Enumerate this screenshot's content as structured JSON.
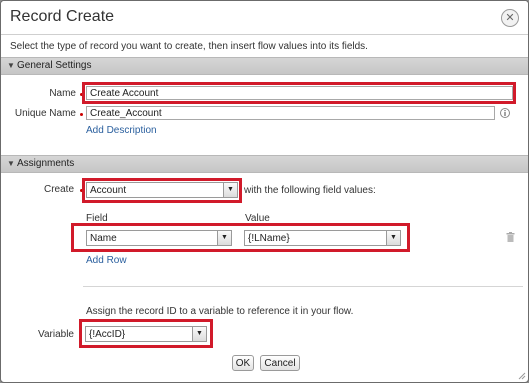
{
  "dialog": {
    "title": "Record Create",
    "intro": "Select the type of record you want to create, then insert flow values into its fields."
  },
  "general": {
    "header": "General Settings",
    "name_label": "Name",
    "name_value": "Create Account",
    "unique_label": "Unique Name",
    "unique_value": "Create_Account",
    "add_description": "Add Description"
  },
  "assignments": {
    "header": "Assignments",
    "create_label": "Create",
    "create_value": "Account",
    "with_text": "with the following field values:",
    "field_header": "Field",
    "value_header": "Value",
    "field_value": "Name",
    "value_value": "{!LName}",
    "add_row": "Add Row",
    "assign_note": "Assign the record ID to a variable to reference it in your flow.",
    "variable_label": "Variable",
    "variable_value": "{!AccID}"
  },
  "buttons": {
    "ok": "OK",
    "cancel": "Cancel"
  },
  "colors": {
    "highlight": "#d11a2a",
    "link": "#2a5f9e",
    "section": "#cccccc"
  },
  "icons": [
    "close-icon",
    "collapse-triangle-icon",
    "chevron-down-icon",
    "trash-icon",
    "resize-grip-icon"
  ]
}
